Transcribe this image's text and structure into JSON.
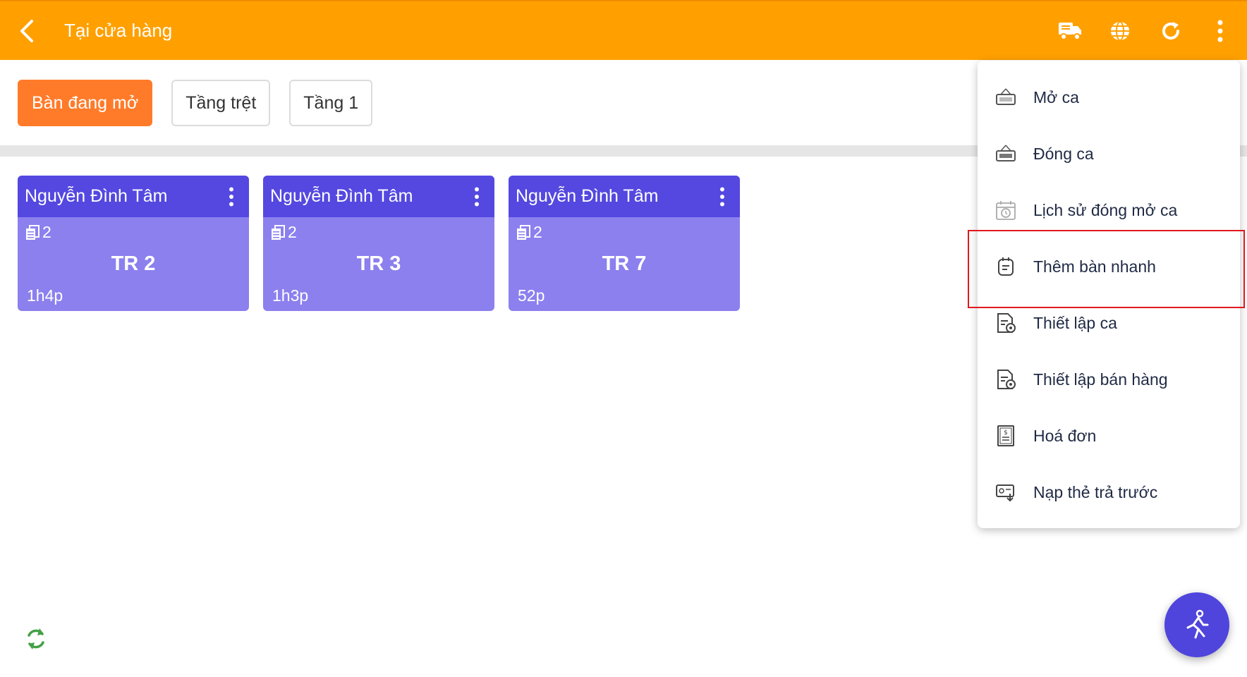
{
  "header": {
    "title": "Tại cửa hàng",
    "icons": [
      "back-arrow-icon",
      "delivery-truck-icon",
      "globe-icon",
      "refresh-icon",
      "more-vertical-icon"
    ],
    "background_color": "#ffa000"
  },
  "filters": [
    {
      "label": "Bàn đang mở",
      "active": true
    },
    {
      "label": "Tầng trệt",
      "active": false
    },
    {
      "label": "Tầng 1",
      "active": false
    }
  ],
  "tables": [
    {
      "customer": "Nguyễn Đình Tâm",
      "count": "2",
      "code": "TR 2",
      "elapsed": "1h4p"
    },
    {
      "customer": "Nguyễn Đình Tâm",
      "count": "2",
      "code": "TR 3",
      "elapsed": "1h3p"
    },
    {
      "customer": "Nguyễn Đình Tâm",
      "count": "2",
      "code": "TR 7",
      "elapsed": "52p"
    }
  ],
  "menu": {
    "items": [
      {
        "label": "Mở ca",
        "icon": "open-sign-icon"
      },
      {
        "label": "Đóng ca",
        "icon": "closed-sign-icon"
      },
      {
        "label": "Lịch sử đóng mở ca",
        "icon": "calendar-clock-icon"
      },
      {
        "label": "Thêm bàn nhanh",
        "icon": "quick-add-table-icon",
        "highlighted": true
      },
      {
        "label": "Thiết lập ca",
        "icon": "document-settings-icon"
      },
      {
        "label": "Thiết lập bán hàng",
        "icon": "document-settings-icon"
      },
      {
        "label": "Hoá đơn",
        "icon": "invoice-icon"
      },
      {
        "label": "Nạp thẻ trả trước",
        "icon": "prepaid-card-icon"
      }
    ]
  },
  "colors": {
    "accent": "#ff7b2a",
    "card_header": "#5448e0",
    "card_body": "#8b80ee",
    "fab": "#4f45dc",
    "highlight_border": "#e0191e",
    "sync": "#43a047"
  }
}
